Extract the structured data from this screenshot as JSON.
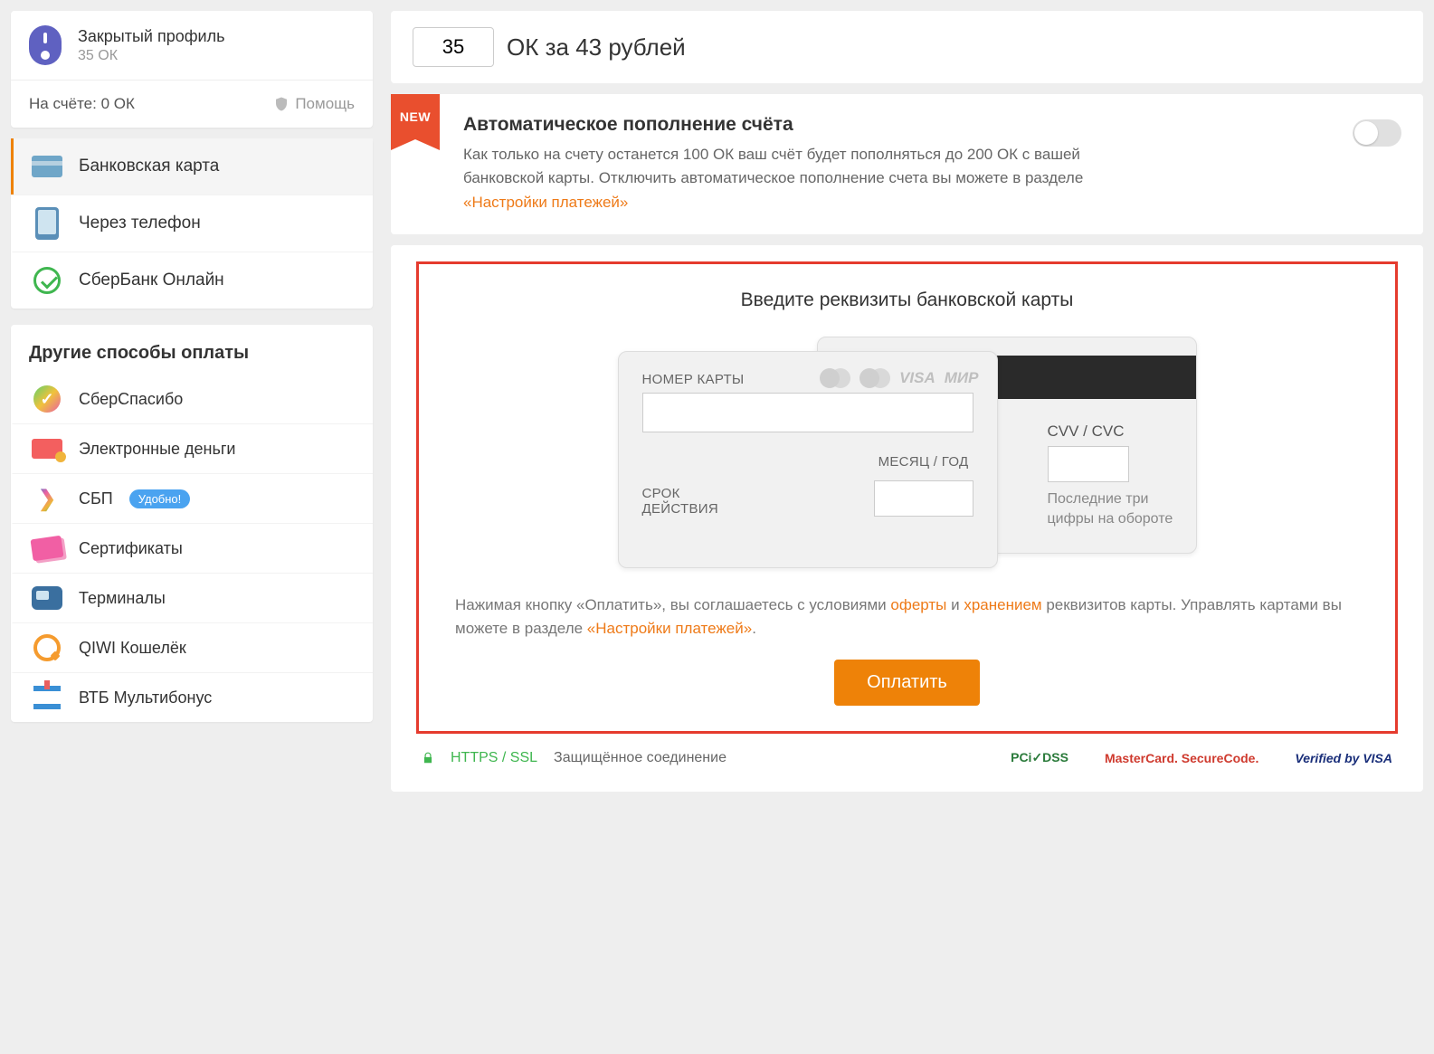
{
  "profile": {
    "name": "Закрытый профиль",
    "sub": "35 ОК"
  },
  "balance": "На счёте: 0 ОК",
  "help": "Помощь",
  "methods": {
    "card": "Банковская карта",
    "phone": "Через телефон",
    "sber": "СберБанк Онлайн"
  },
  "other_title": "Другие способы оплаты",
  "other": {
    "sberspasibo": "СберСпасибо",
    "emoney": "Электронные деньги",
    "sbp": "СБП",
    "sbp_badge": "Удобно!",
    "cert": "Сертификаты",
    "term": "Терминалы",
    "qiwi": "QIWI Кошелёк",
    "vtb": "ВТБ Мультибонус"
  },
  "top": {
    "amount": "35",
    "label": "ОК за 43 рублей"
  },
  "auto": {
    "new": "NEW",
    "title": "Автоматическое пополнение счёта",
    "desc1": "Как только на счету останется 100 ОК ваш счёт будет пополняться до 200 ОК с вашей банковской карты. Отключить автоматическое пополнение счета вы можете в разделе ",
    "link": "«Настройки платежей»"
  },
  "form": {
    "title": "Введите реквизиты банковской карты",
    "card_number": "НОМЕР КАРТЫ",
    "expiry": "СРОК\nДЕЙСТВИЯ",
    "expiry_l1": "СРОК",
    "expiry_l2": "ДЕЙСТВИЯ",
    "month_year": "МЕСЯЦ / ГОД",
    "cvv": "CVV / CVC",
    "cvv_hint": "Последние три цифры на обороте",
    "visa": "VISA",
    "mir": "МИР"
  },
  "agree": {
    "t1": "Нажимая кнопку «Оплатить», вы соглашаетесь с условиями ",
    "a1": "оферты",
    "t2": " и ",
    "a2": "хранением",
    "t3": " реквизитов карты. Управлять картами вы можете в разделе ",
    "a3": "«Настройки платежей»",
    "t4": "."
  },
  "pay_button": "Оплатить",
  "security": {
    "https": "HTTPS / SSL",
    "secure": "Защищённое соединение",
    "pci": "PCi✓DSS",
    "msc": "MasterCard. SecureCode.",
    "vbv": "Verified by VISA"
  }
}
